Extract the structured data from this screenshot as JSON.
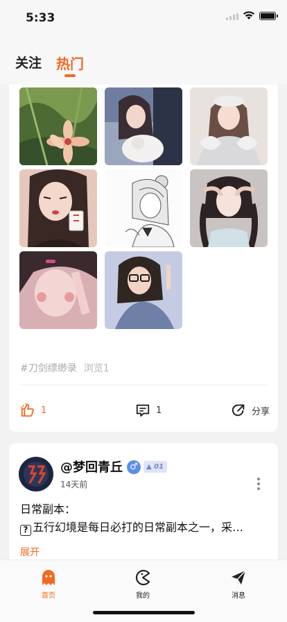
{
  "status_bar": {
    "time": "5:33"
  },
  "top_tabs": [
    {
      "label": "关注",
      "active": false
    },
    {
      "label": "热门",
      "active": true
    }
  ],
  "accent_color": "#f26a21",
  "post1": {
    "images": [
      {
        "name": "flower-painting"
      },
      {
        "name": "girl-with-cat"
      },
      {
        "name": "girl-white-outfit"
      },
      {
        "name": "girl-with-card"
      },
      {
        "name": "sketch-girl"
      },
      {
        "name": "girl-braids"
      },
      {
        "name": "girl-closeup"
      },
      {
        "name": "girl-glasses"
      }
    ],
    "tag": "#刀剑缥缈录",
    "views": "浏览1",
    "like_count": "1",
    "comment_count": "1",
    "share_label": "分享"
  },
  "post2": {
    "username": "@梦回青丘",
    "gender_symbol": "♂",
    "level": "01",
    "time": "14天前",
    "title": "日常副本：",
    "body_badge": "?",
    "body": "五行幻境是每日必打的日常副本之一，采…",
    "expand": "展开"
  },
  "bottom_nav": [
    {
      "label": "首页",
      "icon": "ghost-icon",
      "active": true
    },
    {
      "label": "我的",
      "icon": "pacman-icon",
      "active": false
    },
    {
      "label": "消息",
      "icon": "send-icon",
      "active": false
    }
  ]
}
